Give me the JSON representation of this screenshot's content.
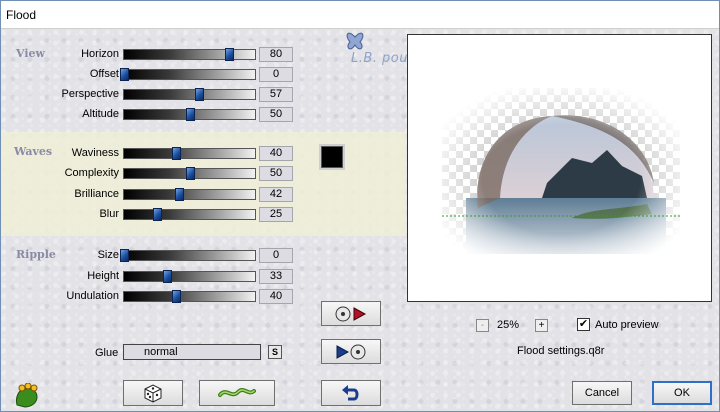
{
  "window": {
    "title": "Flood"
  },
  "watermark": "L.B. pour Animabelle",
  "sections": [
    {
      "label": "View",
      "params": [
        {
          "label": "Horizon",
          "value": 80,
          "fraction": 0.8
        },
        {
          "label": "Offset",
          "value": 0,
          "fraction": 0.0
        },
        {
          "label": "Perspective",
          "value": 57,
          "fraction": 0.57
        },
        {
          "label": "Altitude",
          "value": 50,
          "fraction": 0.5
        }
      ]
    },
    {
      "label": "Waves",
      "params": [
        {
          "label": "Waviness",
          "value": 40,
          "fraction": 0.4
        },
        {
          "label": "Complexity",
          "value": 50,
          "fraction": 0.5
        },
        {
          "label": "Brilliance",
          "value": 42,
          "fraction": 0.42
        },
        {
          "label": "Blur",
          "value": 25,
          "fraction": 0.25
        }
      ]
    },
    {
      "label": "Ripple",
      "params": [
        {
          "label": "Size",
          "value": 0,
          "fraction": 0.0
        },
        {
          "label": "Height",
          "value": 33,
          "fraction": 0.33
        },
        {
          "label": "Undulation",
          "value": 40,
          "fraction": 0.4
        }
      ]
    }
  ],
  "waves_color": "#000000",
  "glue": {
    "label": "Glue",
    "value": "normal",
    "button": "S"
  },
  "preview": {
    "zoom": "25%",
    "zoom_minus": "-",
    "zoom_plus": "+",
    "auto_preview_label": "Auto preview",
    "auto_preview_checked": true,
    "auto_preview_mark": "✔",
    "settings_name": "Flood settings.q8r"
  },
  "buttons": {
    "cancel": "Cancel",
    "ok": "OK"
  },
  "icons": {
    "logo": "frog-hand-icon",
    "random": "dice-icon",
    "reset": "wave-icon",
    "undo": "undo-icon",
    "load": "disk-play-icon",
    "save": "play-disk-icon"
  }
}
